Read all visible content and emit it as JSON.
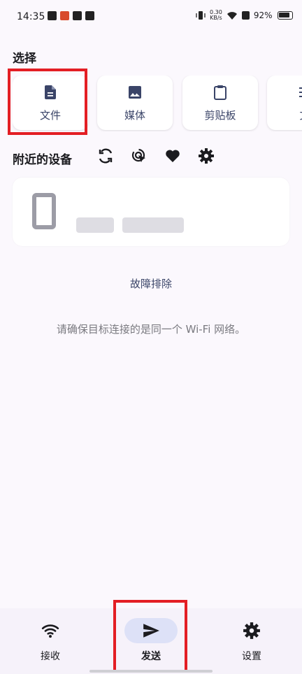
{
  "status_bar": {
    "time": "14:35",
    "net_speed_value": "0.30",
    "net_speed_unit": "KB/s",
    "battery": "92%"
  },
  "select": {
    "title": "选择",
    "cards": [
      {
        "label": "文件",
        "icon": "file-icon"
      },
      {
        "label": "媒体",
        "icon": "image-icon"
      },
      {
        "label": "剪贴板",
        "icon": "clipboard-icon"
      },
      {
        "label": "文",
        "icon": "text-icon"
      }
    ]
  },
  "nearby": {
    "title": "附近的设备",
    "tools": [
      "refresh-icon",
      "scan-click-icon",
      "favorite-heart-icon",
      "settings-gear-icon"
    ]
  },
  "troubleshoot_label": "故障排除",
  "hint": "请确保目标连接的是同一个 Wi-Fi 网络。",
  "bottom_nav": {
    "items": [
      {
        "label": "接收",
        "icon": "wifi-icon",
        "active": false
      },
      {
        "label": "发送",
        "icon": "send-icon",
        "active": true
      },
      {
        "label": "设置",
        "icon": "settings-icon",
        "active": false
      }
    ]
  },
  "colors": {
    "highlight": "#E31E24",
    "accent": "#3A4468",
    "nav_active_pill": "#DDE1F7",
    "background": "#FBF8FD"
  }
}
